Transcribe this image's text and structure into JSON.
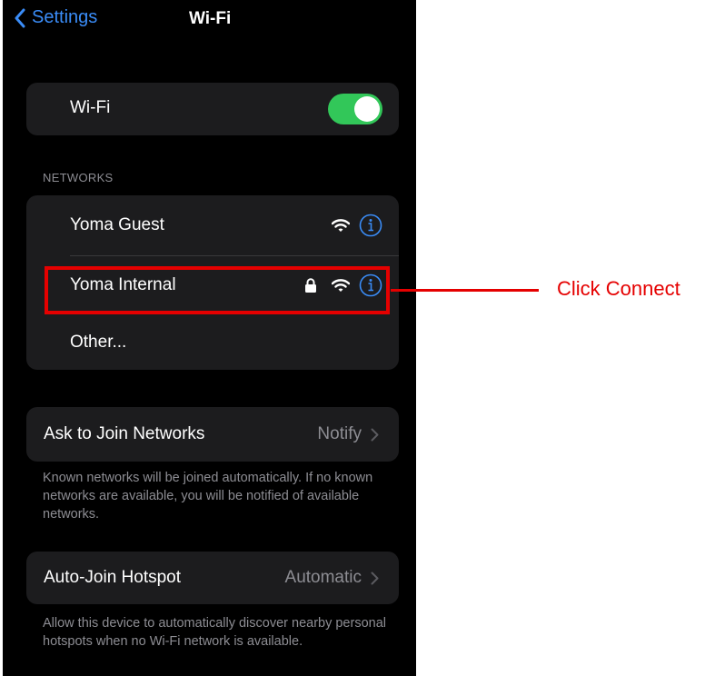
{
  "nav": {
    "back_label": "Settings",
    "title": "Wi-Fi"
  },
  "wifi": {
    "label": "Wi-Fi",
    "enabled": true
  },
  "networks": {
    "header": "NETWORKS",
    "items": [
      {
        "name": "Yoma Guest",
        "locked": false
      },
      {
        "name": "Yoma Internal",
        "locked": true
      },
      {
        "name": "Other..."
      }
    ]
  },
  "ask_to_join": {
    "label": "Ask to Join Networks",
    "value": "Notify",
    "footnote": "Known networks will be joined automatically. If no known networks are available, you will be notified of available networks."
  },
  "auto_join": {
    "label": "Auto-Join Hotspot",
    "value": "Automatic",
    "footnote": "Allow this device to automatically discover nearby personal hotspots when no Wi-Fi network is available."
  },
  "annotation": {
    "text": "Click Connect"
  },
  "colors": {
    "accent": "#3a8cf7",
    "toggle_on": "#32c759",
    "annotation": "#e50000"
  },
  "icons": {
    "back": "chevron-left-icon",
    "wifi": "wifi-signal-icon",
    "info": "info-icon",
    "lock": "lock-icon",
    "chevron": "chevron-right-icon"
  }
}
